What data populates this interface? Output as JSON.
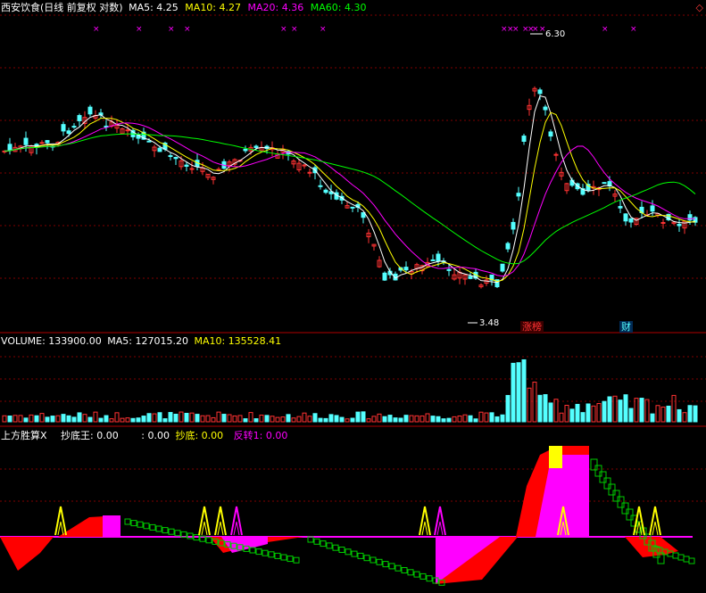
{
  "main_pane": {
    "stock_name": "西安饮食",
    "period_info": "(日线 前复权 对数)",
    "indicators": [
      {
        "label": "MA5: 4.25",
        "color": "#ffffff"
      },
      {
        "label": "MA10: 4.27",
        "color": "#ffff00"
      },
      {
        "label": "MA20: 4.36",
        "color": "#ff00ff"
      },
      {
        "label": "MA60: 4.30",
        "color": "#00ff00"
      }
    ],
    "max_price_label": "6.30",
    "min_price_label": "3.48",
    "event_tags": [
      "涨榜",
      "财"
    ]
  },
  "volume_pane": {
    "indicators": [
      {
        "label": "VOLUME: 133900.00",
        "color": "#ffffff"
      },
      {
        "label": "MA5: 127015.20",
        "color": "#ffffff"
      },
      {
        "label": "MA10: 135528.41",
        "color": "#ffff00"
      }
    ]
  },
  "indicator_pane": {
    "labels": [
      {
        "label": "上方胜算X",
        "color": "#ffffff"
      },
      {
        "label": "抄底王: 0.00",
        "color": "#ffffff"
      },
      {
        "label": ": 0.00",
        "color": "#ffffff"
      },
      {
        "label": "抄底: 0.00",
        "color": "#ffff00"
      },
      {
        "label": "反转1: 0.00",
        "color": "#ff00ff"
      }
    ]
  },
  "colors": {
    "up": "#ff3232",
    "down": "#54ffff",
    "ma5": "#ffffff",
    "ma10": "#ffff00",
    "ma20": "#ff00ff",
    "ma60": "#00ff00",
    "grid": "#800000",
    "marker": "#ff00ff"
  },
  "icons": {
    "corner": "diamond-outline-icon"
  }
}
